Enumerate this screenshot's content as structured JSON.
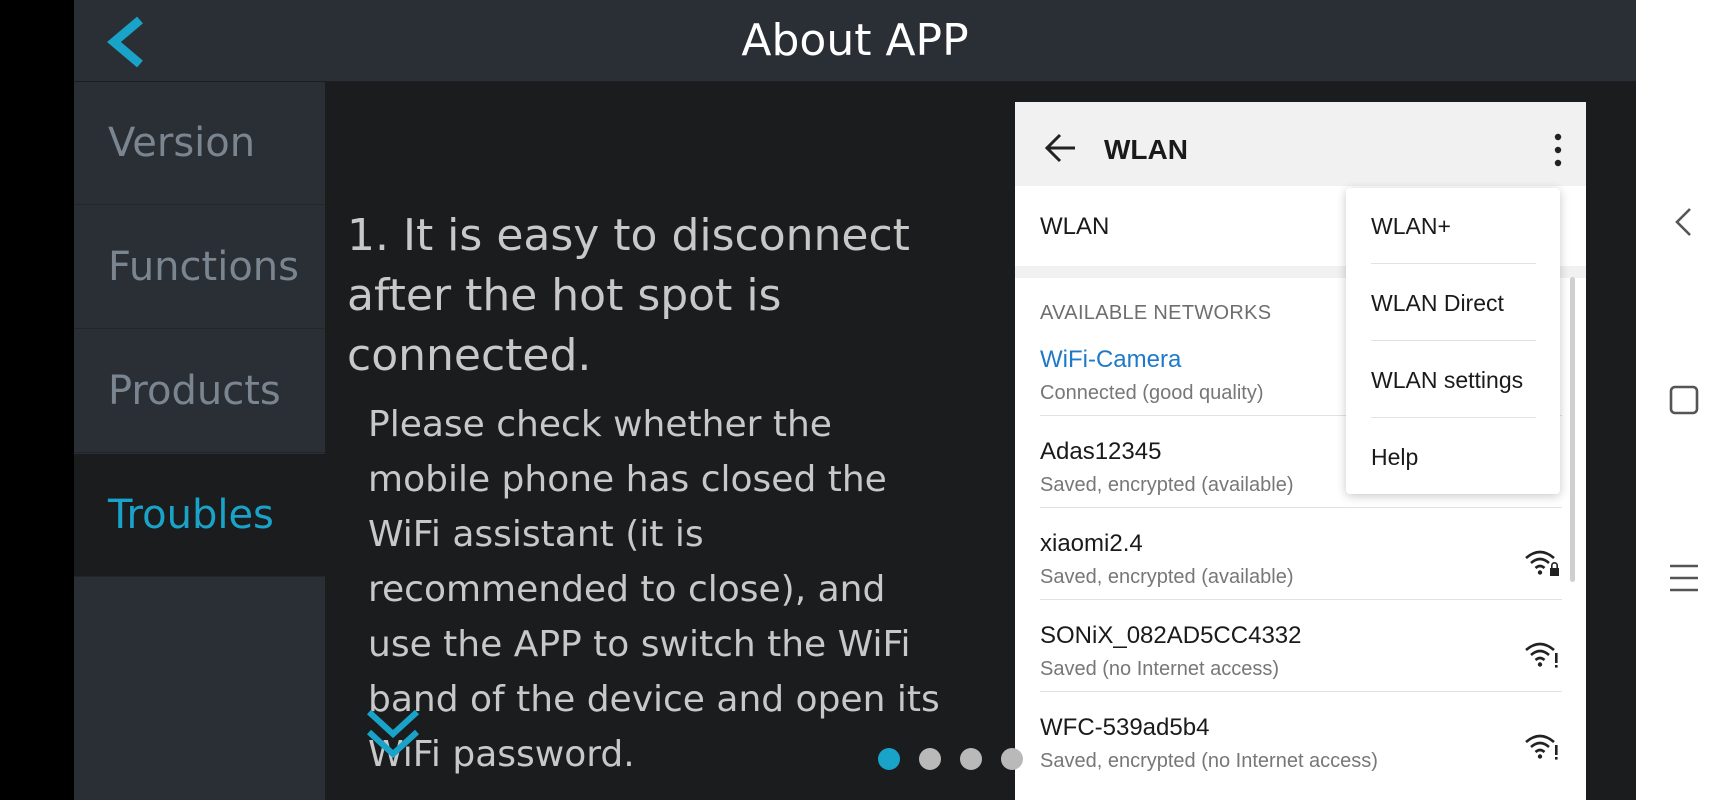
{
  "header": {
    "title": "About APP",
    "back_icon": "chevron-left-icon"
  },
  "sidebar": {
    "items": [
      {
        "label": "Version",
        "active": false
      },
      {
        "label": "Functions",
        "active": false
      },
      {
        "label": "Products",
        "active": false
      },
      {
        "label": "Troubles",
        "active": true
      }
    ]
  },
  "content": {
    "question_title": "1. It is easy to disconnect after the hot spot is connected.",
    "answer_body": "Please check whether the mobile phone has closed the WiFi assistant (it is recommended to close), and use the APP to switch the WiFi band of the device and open its WiFi password.",
    "more_icon": "double-chevron-down-icon",
    "pager": {
      "total": 4,
      "current": 1
    }
  },
  "phone_screenshot": {
    "title": "WLAN",
    "wlan_toggle_label": "WLAN",
    "section_label": "AVAILABLE NETWORKS",
    "networks": [
      {
        "name": "WiFi-Camera",
        "status": "Connected (good quality)"
      },
      {
        "name": "Adas12345",
        "status": "Saved, encrypted (available)"
      },
      {
        "name": "xiaomi2.4",
        "status": "Saved, encrypted (available)"
      },
      {
        "name": "SONiX_082AD5CC4332",
        "status": "Saved (no Internet access)"
      },
      {
        "name": "WFC-539ad5b4",
        "status": "Saved, encrypted (no Internet access)"
      }
    ],
    "menu": [
      "WLAN+",
      "WLAN Direct",
      "WLAN settings",
      "Help"
    ],
    "colors": {
      "connected": "#1f79c9"
    }
  },
  "nav_bar": {
    "icons": [
      "back-triangle-icon",
      "home-square-icon",
      "menu-lines-icon"
    ]
  },
  "colors": {
    "accent": "#1aa3c8",
    "header_bg": "#2a2f36",
    "content_bg": "#1b1c1e"
  }
}
